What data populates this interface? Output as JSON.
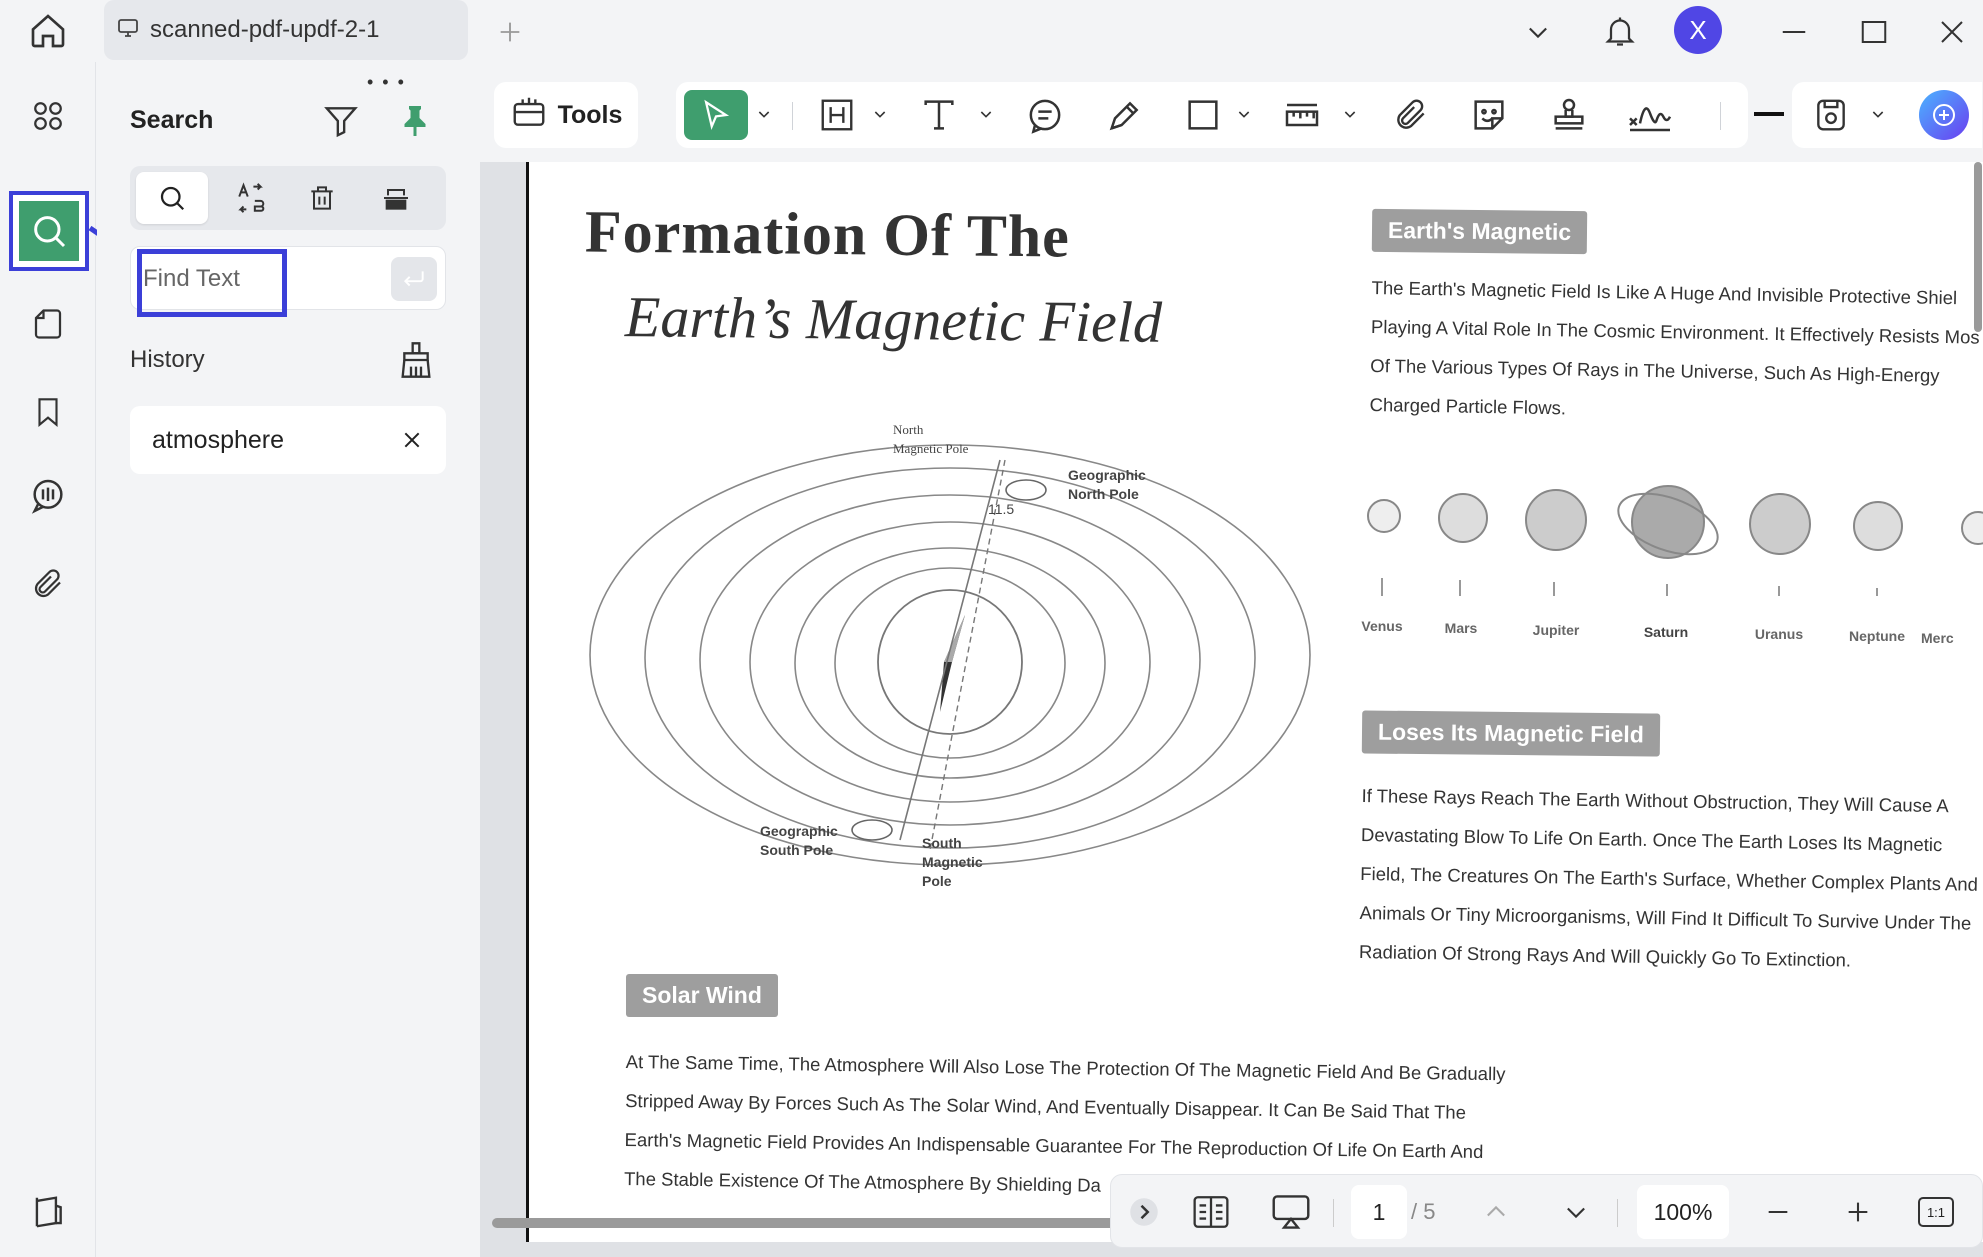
{
  "titlebar": {
    "tab_title": "scanned-pdf-updf-2-1",
    "avatar_letter": "X"
  },
  "panel": {
    "title": "Search",
    "find_placeholder": "Find Text",
    "history_label": "History",
    "history_items": [
      "atmosphere"
    ]
  },
  "toolbar": {
    "tools_label": "Tools"
  },
  "document": {
    "title_line1": "Formation Of The",
    "title_line2": "Earth’s Magnetic Field",
    "sec1_heading": "Earth's Magnetic",
    "sec1_lines": [
      "The Earth's Magnetic Field Is Like A Huge And Invisible Protective Shiel",
      "Playing A Vital Role In The Cosmic Environment. It Effectively Resists Mos",
      "Of The Various Types Of Rays in The Universe, Such As High-Energy",
      "Charged Particle Flows."
    ],
    "planets": [
      "Venus",
      "Mars",
      "Jupiter",
      "Saturn",
      "Uranus",
      "Neptune",
      "Merc"
    ],
    "sec2_heading": "Loses Its Magnetic Field",
    "sec2_lines": [
      "If These Rays Reach The Earth Without Obstruction, They Will Cause A",
      "Devastating Blow To Life On Earth. Once The Earth Loses Its Magnetic",
      "Field, The Creatures On The Earth's Surface, Whether Complex Plants And",
      "Animals Or Tiny Microorganisms, Will Find It Difficult To Survive Under The",
      "Radiation Of Strong Rays And Will Quickly Go To Extinction."
    ],
    "sec3_heading": "Solar Wind",
    "sec3_lines": [
      "At The Same Time, The Atmosphere Will Also Lose The Protection Of The Magnetic Field And Be Gradually",
      "Stripped Away By Forces Such As The Solar Wind, And Eventually Disappear. It Can Be Said That The",
      "Earth's Magnetic Field Provides An Indispensable Guarantee For The Reproduction Of Life On Earth And",
      "The Stable Existence Of The Atmosphere By Shielding Da"
    ],
    "diagram": {
      "north_magnetic": "North\nMagnetic Pole",
      "geo_north": "Geographic\nNorth Pole",
      "angle": "11.5",
      "geo_south": "Geographic\nSouth Pole",
      "south_magnetic": "South\nMagnetic\nPole"
    }
  },
  "bottom": {
    "current_page": "1",
    "total_pages": "/ 5",
    "zoom": "100%",
    "fit_label": "1:1"
  },
  "colors": {
    "accent_green": "#3f9e6e",
    "highlight_blue": "#3b3fd8",
    "avatar": "#5046e5"
  }
}
